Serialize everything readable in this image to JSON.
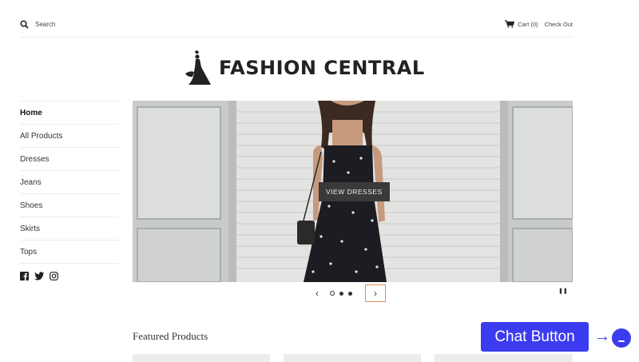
{
  "header": {
    "search_label": "Search",
    "cart_label": "Cart (0)",
    "checkout_label": "Check Out"
  },
  "brand": {
    "name": "FASHION CENTRAL"
  },
  "sidebar": {
    "items": [
      {
        "label": "Home",
        "active": true
      },
      {
        "label": "All Products"
      },
      {
        "label": "Dresses"
      },
      {
        "label": "Jeans"
      },
      {
        "label": "Shoes"
      },
      {
        "label": "Skirts"
      },
      {
        "label": "Tops"
      }
    ],
    "social_icons": [
      "facebook-icon",
      "twitter-icon",
      "instagram-icon"
    ]
  },
  "hero": {
    "button_label": "VIEW DRESSES",
    "slide_count": 3,
    "active_slide": 1
  },
  "featured": {
    "title": "Featured Products"
  },
  "chat": {
    "label": "Chat Button"
  },
  "colors": {
    "accent": "#3b3bf0",
    "focus": "#e58a5b",
    "hero_button": "#3a3a3a"
  }
}
